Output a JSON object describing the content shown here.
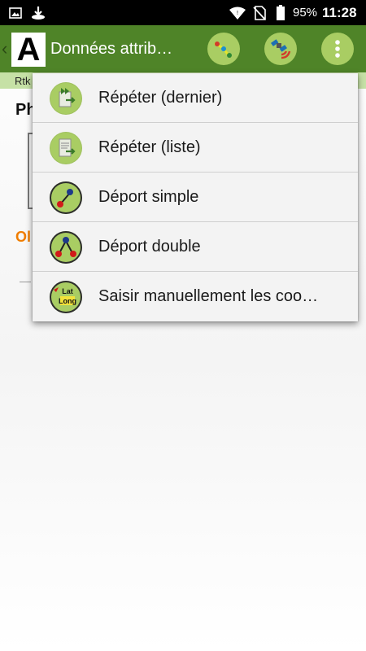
{
  "status_bar": {
    "icons": [
      "image-icon",
      "download-icon",
      "wifi-icon",
      "no-sim-icon",
      "battery-icon"
    ],
    "battery": "95%",
    "time": "11:28"
  },
  "app_bar": {
    "logo_letter": "A",
    "title": "Données attrib…",
    "actions": [
      "survey-points-icon",
      "gps-satellite-icon",
      "overflow-menu-icon"
    ],
    "accent": "#4f8428",
    "icon_bg": "#a9cd63"
  },
  "sub_strip": {
    "text": "Rtk"
  },
  "background": {
    "heading": "Ph",
    "orange_text": "Ol",
    "orange_color": "#f07d00"
  },
  "menu": {
    "items": [
      {
        "label": "Répéter (dernier)",
        "icon": "repeat-last-icon"
      },
      {
        "label": "Répéter (liste)",
        "icon": "repeat-list-icon"
      },
      {
        "label": "Déport simple",
        "icon": "single-offset-icon"
      },
      {
        "label": "Déport double",
        "icon": "double-offset-icon"
      },
      {
        "label": "Saisir manuellement les coo…",
        "icon": "lat-long-icon",
        "icon_text_1": "Lat",
        "icon_text_2": "Long"
      }
    ]
  }
}
